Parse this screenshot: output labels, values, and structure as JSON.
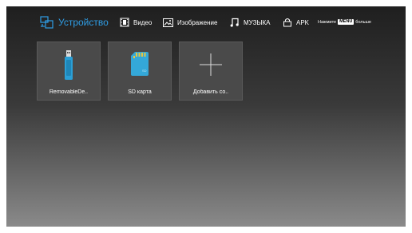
{
  "nav": {
    "tabs": [
      {
        "label": "Устройство",
        "icon": "devices-icon",
        "active": true
      },
      {
        "label": "Видео",
        "icon": "film-icon",
        "active": false
      },
      {
        "label": "Изображение",
        "icon": "image-icon",
        "active": false
      },
      {
        "label": "МУЗЫКА",
        "icon": "music-note-icon",
        "active": false
      },
      {
        "label": "APK",
        "icon": "bag-icon",
        "active": false
      }
    ],
    "hint_prefix": "Нажмите",
    "hint_key": "MENU",
    "hint_suffix": "больше"
  },
  "tiles": [
    {
      "label": "RemovableDe..",
      "icon": "usb-drive-icon"
    },
    {
      "label": "SD карта",
      "icon": "sd-card-icon"
    },
    {
      "label": "Добавить со..",
      "icon": "plus-icon"
    }
  ],
  "colors": {
    "accent": "#2f9ee6",
    "usb": "#2a9fd6",
    "sd": "#34a8d8"
  }
}
